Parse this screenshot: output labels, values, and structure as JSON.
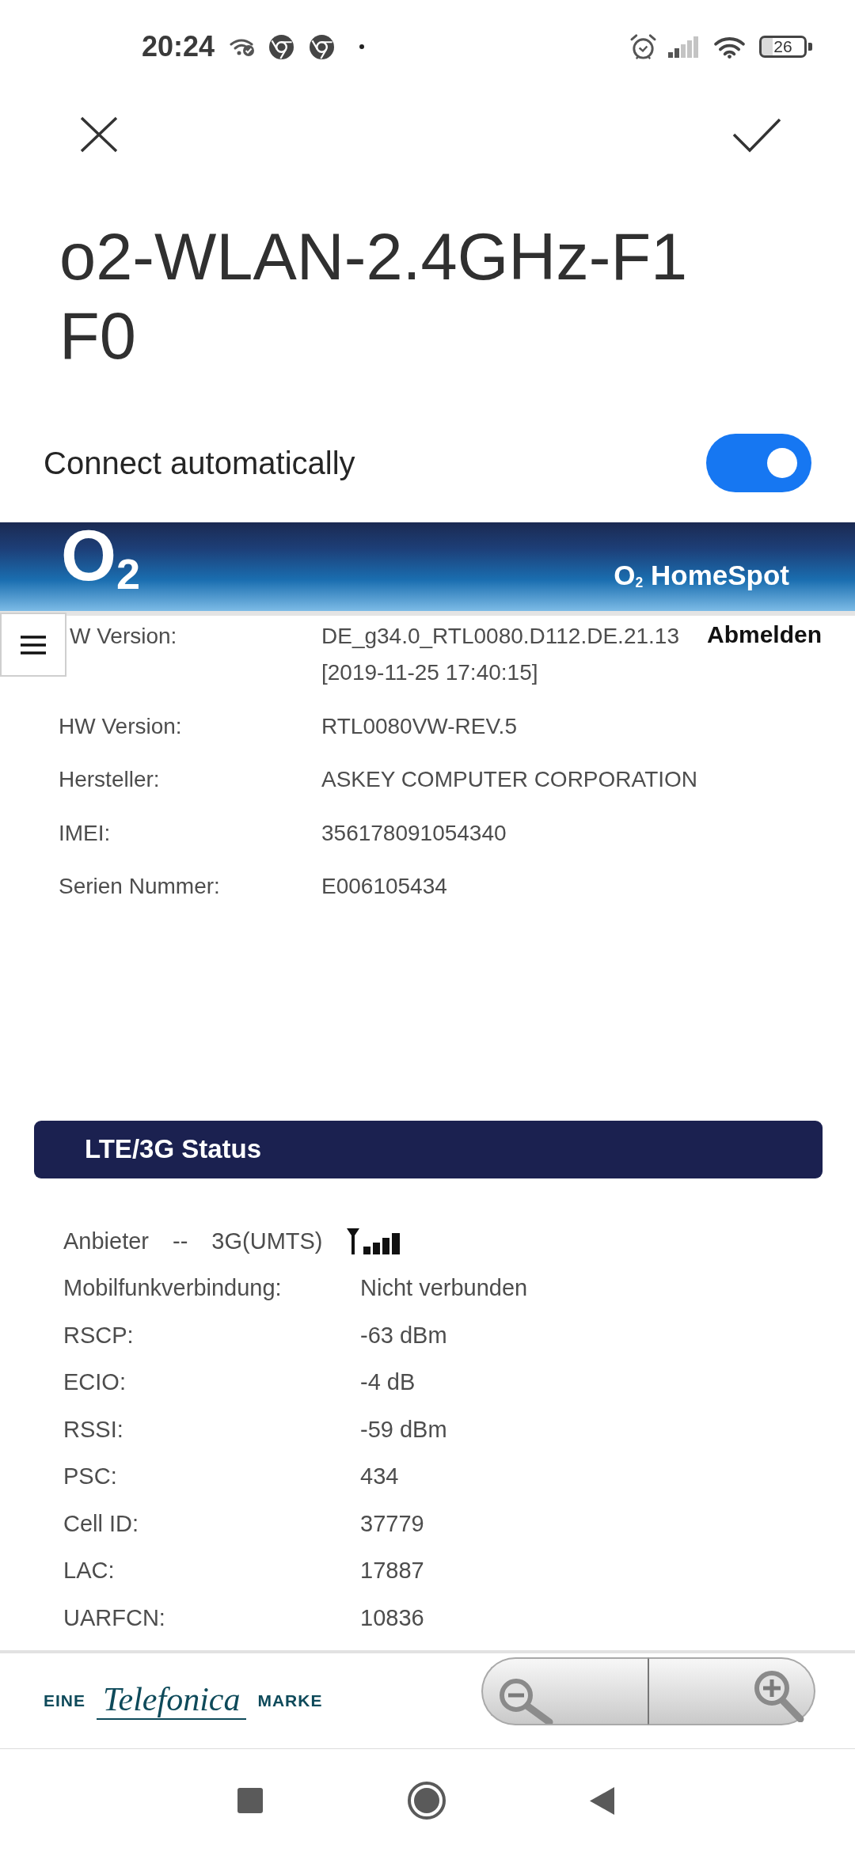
{
  "status_bar": {
    "time": "20:24",
    "battery": "26"
  },
  "dialog": {
    "title": "o2-WLAN-2.4GHz-F1F0",
    "auto_connect": {
      "label": "Connect automatically",
      "on": true
    }
  },
  "webpage": {
    "header": {
      "logo": "O$_{2}$",
      "brand": "O$_{2}$ HomeSpot",
      "logout": "Abmelden"
    },
    "device_info": [
      {
        "label": "W Version:",
        "value": "DE_g34.0_RTL0080.D112.DE.21.13 [2019-11-25 17:40:15]"
      },
      {
        "label": "HW Version:",
        "value": "RTL0080VW-REV.5"
      },
      {
        "label": "Hersteller:",
        "value": "ASKEY COMPUTER CORPORATION"
      },
      {
        "label": "IMEI:",
        "value": "356178091054340"
      },
      {
        "label": "Serien Nummer:",
        "value": "E006105434"
      }
    ],
    "lte_status": {
      "title": "LTE/3G Status",
      "provider": {
        "label": "Anbieter",
        "operator": "--",
        "network": "3G(UMTS)"
      },
      "rows": [
        {
          "label": "Mobilfunkverbindung:",
          "value": "Nicht verbunden"
        },
        {
          "label": "RSCP:",
          "value": "-63 dBm"
        },
        {
          "label": "ECIO:",
          "value": "-4 dB"
        },
        {
          "label": "RSSI:",
          "value": "-59 dBm"
        },
        {
          "label": "PSC:",
          "value": "434"
        },
        {
          "label": "Cell ID:",
          "value": "37779"
        },
        {
          "label": "LAC:",
          "value": "17887"
        },
        {
          "label": "UARFCN:",
          "value": "10836"
        }
      ]
    },
    "footer": {
      "brand": {
        "prefix": "EINE",
        "name": "Telefonica",
        "suffix": "MARKE"
      }
    }
  }
}
